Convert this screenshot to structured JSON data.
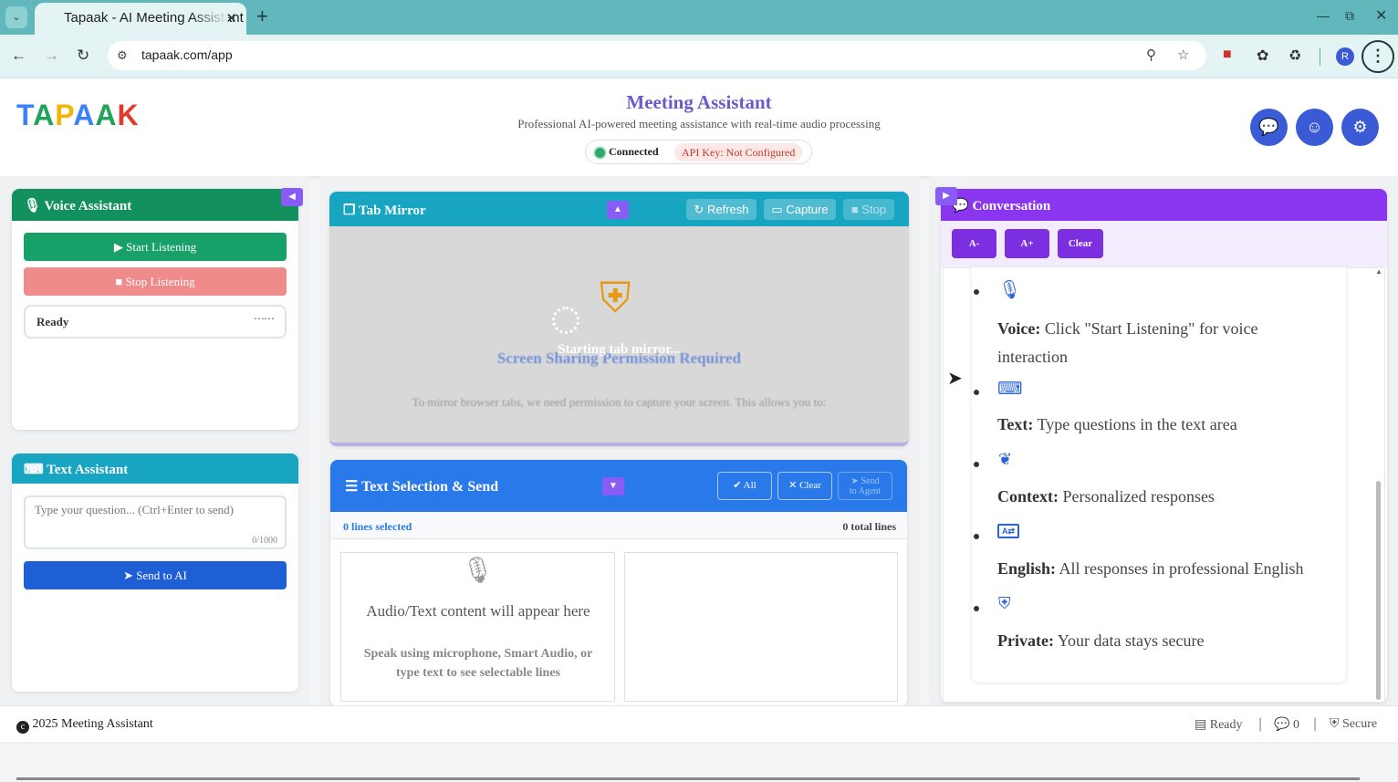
{
  "browser": {
    "tab_title": "Tapaak - AI Meeting Assistant",
    "url": "tapaak.com/app",
    "profile_initial": "R"
  },
  "header": {
    "logo_letters": [
      "T",
      "A",
      "P",
      "A",
      "A",
      "K"
    ],
    "logo_colors": [
      "#3b82f6",
      "#22a35a",
      "#f2b705",
      "#3b82f6",
      "#22a35a",
      "#e23b2e"
    ],
    "title": "Meeting Assistant",
    "subtitle": "Professional AI-powered meeting assistance with real-time audio processing",
    "status": "Connected",
    "api_key": "API Key: Not Configured"
  },
  "voice": {
    "title": "Voice Assistant",
    "start": "Start Listening",
    "stop": "Stop Listening",
    "status": "Ready"
  },
  "text_assistant": {
    "title": "Text Assistant",
    "placeholder": "Type your question... (Ctrl+Enter to send)",
    "counter": "0/1000",
    "send": "Send to AI"
  },
  "tab_mirror": {
    "title": "Tab Mirror",
    "refresh": "Refresh",
    "capture": "Capture",
    "stop": "Stop",
    "loading": "Starting tab mirror...",
    "permission_title": "Screen Sharing Permission Required",
    "permission_text": "To mirror browser tabs, we need permission to capture your screen. This allows you to:"
  },
  "selection": {
    "title": "Text Selection & Send",
    "all": "All",
    "clear": "Clear",
    "send_line1": "Send",
    "send_line2": "to Agent",
    "selected": "0 lines selected",
    "total": "0 total lines",
    "empty_title": "Audio/Text content will appear here",
    "empty_text": "Speak using microphone, Smart Audio, or type text to see selectable lines"
  },
  "conversation": {
    "title": "Conversation",
    "font_minus": "A-",
    "font_plus": "A+",
    "clear": "Clear",
    "items": [
      {
        "label": "Voice:",
        "text": "Click \"Start Listening\" for voice",
        "text2": "interaction",
        "icon": "microphone-icon"
      },
      {
        "label": "Text:",
        "text": "Type questions in the text area",
        "icon": "keyboard-icon"
      },
      {
        "label": "Context:",
        "text": "Personalized responses",
        "icon": "brain-icon"
      },
      {
        "label": "English:",
        "text": "All responses in professional English",
        "icon": "language-icon"
      },
      {
        "label": "Private:",
        "text": "Your data stays secure",
        "icon": "shield-icon"
      }
    ]
  },
  "footer": {
    "copyright": "2025 Meeting Assistant",
    "status": "Ready",
    "count": "0",
    "secure": "Secure"
  }
}
